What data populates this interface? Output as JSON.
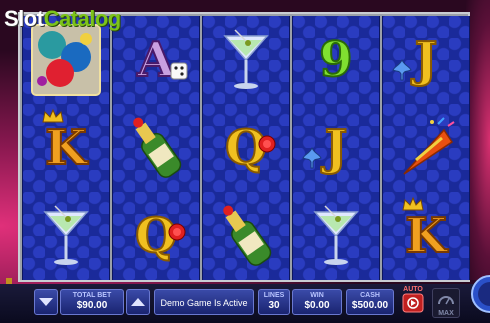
{
  "logo": {
    "part1": "Slot",
    "part2": "Catalog"
  },
  "reels": [
    [
      "fireworks-bonus",
      "K",
      "martini"
    ],
    [
      "A",
      "champagne",
      "Q"
    ],
    [
      "martini",
      "Q",
      "champagne"
    ],
    [
      "9",
      "J",
      "martini"
    ],
    [
      "J",
      "party-horn",
      "K"
    ]
  ],
  "hud": {
    "total_bet_label": "TOTAL BET",
    "total_bet_value": "$90.00",
    "message": "Demo Game Is Active",
    "lines_label": "LINES",
    "lines_value": "30",
    "win_label": "WIN",
    "win_value": "$0.00",
    "cash_label": "CASH",
    "cash_value": "$500.00",
    "auto_label": "AUTO",
    "max_label": "MAX"
  },
  "colors": {
    "reel_blue": "#1a2a9a",
    "hud_blue": "#2a3a98",
    "accent_green": "#7cc41a"
  }
}
